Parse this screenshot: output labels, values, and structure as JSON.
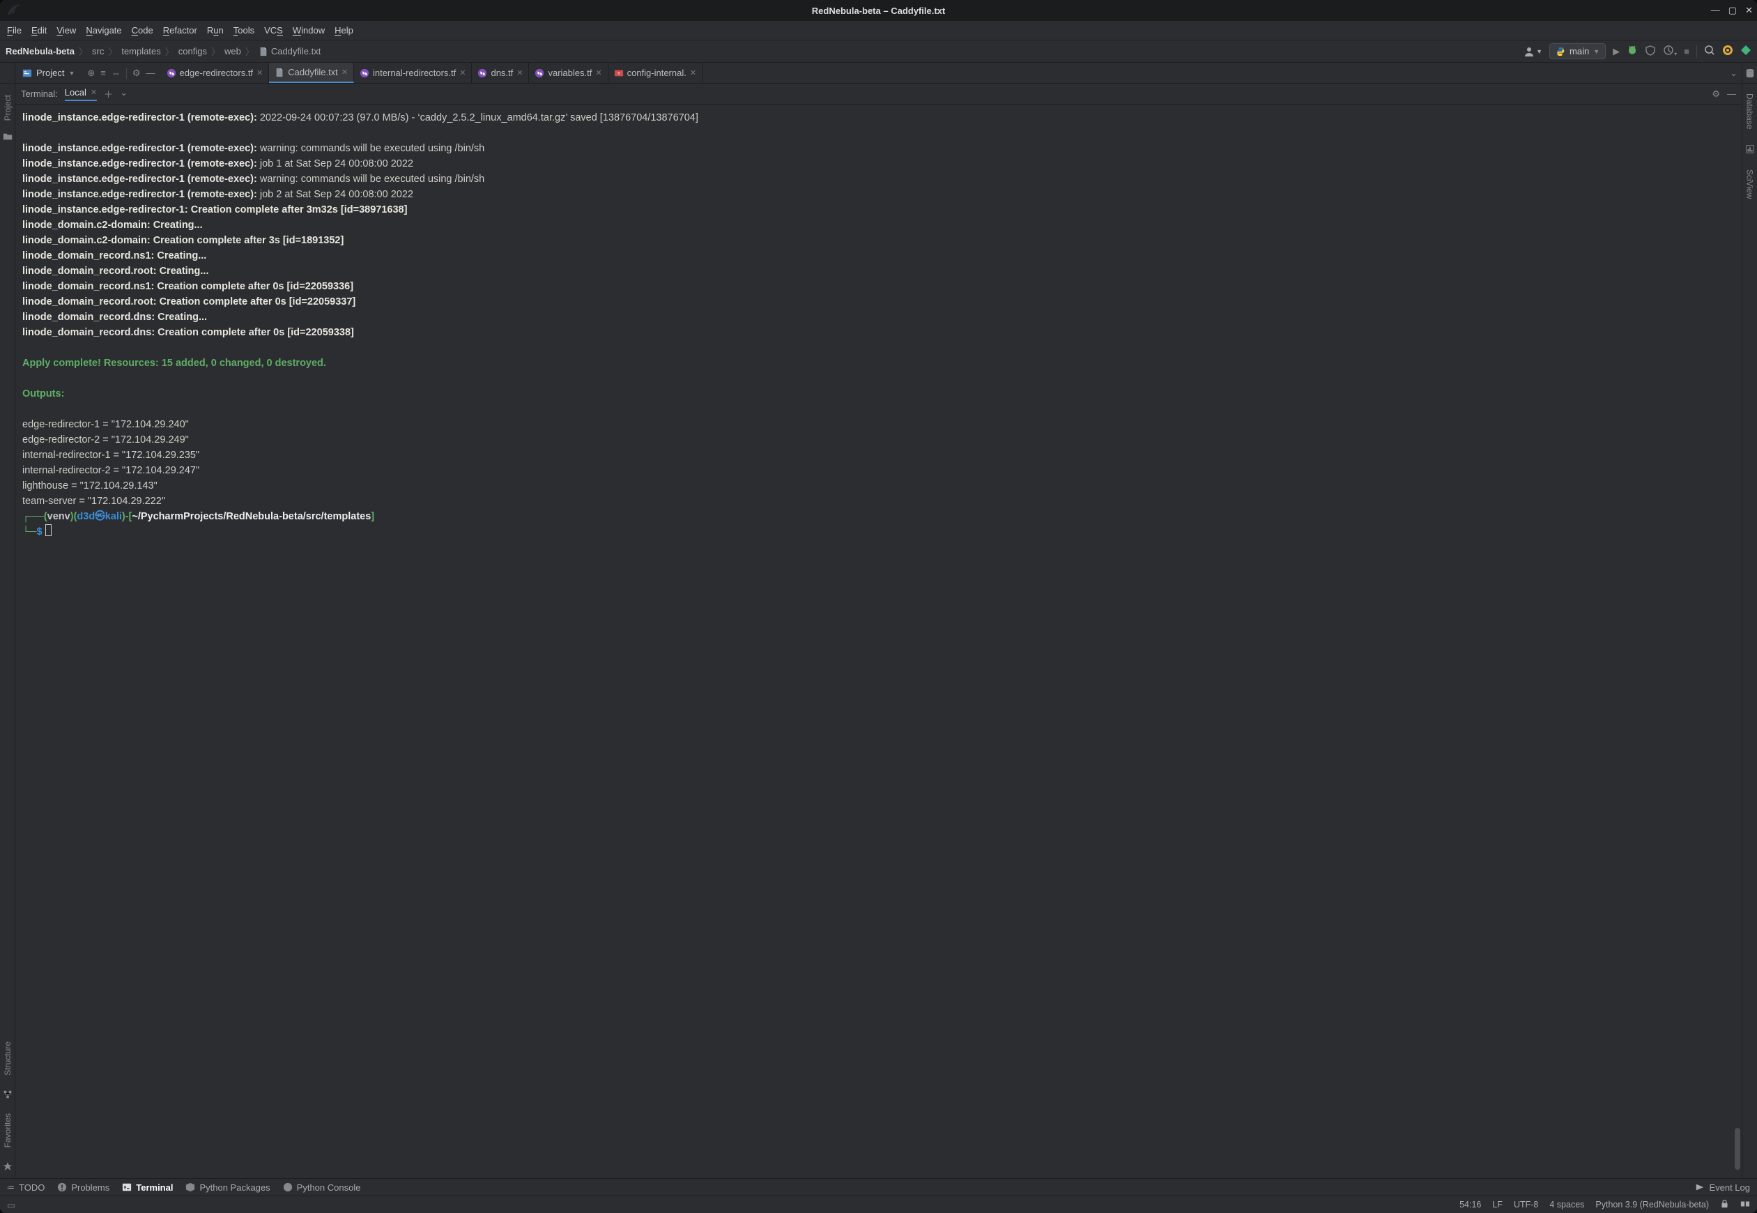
{
  "window": {
    "title": "RedNebula-beta – Caddyfile.txt"
  },
  "menu": {
    "file": "File",
    "edit": "Edit",
    "view": "View",
    "navigate": "Navigate",
    "code": "Code",
    "refactor": "Refactor",
    "run": "Run",
    "tools": "Tools",
    "vcs": "VCS",
    "window": "Window",
    "help": "Help"
  },
  "breadcrumbs": {
    "root": "RedNebula-beta",
    "p1": "src",
    "p2": "templates",
    "p3": "configs",
    "p4": "web",
    "file": "Caddyfile.txt"
  },
  "run_config": {
    "label": "main"
  },
  "project_tool": {
    "label": "Project"
  },
  "editor_tabs": [
    {
      "label": "edge-redirectors.tf",
      "kind": "tf"
    },
    {
      "label": "Caddyfile.txt",
      "kind": "txt",
      "active": true
    },
    {
      "label": "internal-redirectors.tf",
      "kind": "tf"
    },
    {
      "label": "dns.tf",
      "kind": "tf"
    },
    {
      "label": "variables.tf",
      "kind": "tf"
    },
    {
      "label": "config-internal.",
      "kind": "yml"
    }
  ],
  "terminal_header": {
    "title": "Terminal:",
    "tab": "Local"
  },
  "terminal_lines": [
    {
      "bold": "linode_instance.edge-redirector-1 (remote-exec):",
      "rest": " 2022-09-24 00:07:23 (97.0 MB/s) - ‘caddy_2.5.2_linux_amd64.tar.gz’ saved [13876704/13876704]"
    },
    {
      "blank": true
    },
    {
      "bold": "linode_instance.edge-redirector-1 (remote-exec):",
      "rest": " warning: commands will be executed using /bin/sh"
    },
    {
      "bold": "linode_instance.edge-redirector-1 (remote-exec):",
      "rest": " job 1 at Sat Sep 24 00:08:00 2022"
    },
    {
      "bold": "linode_instance.edge-redirector-1 (remote-exec):",
      "rest": " warning: commands will be executed using /bin/sh"
    },
    {
      "bold": "linode_instance.edge-redirector-1 (remote-exec):",
      "rest": " job 2 at Sat Sep 24 00:08:00 2022"
    },
    {
      "bold": "linode_instance.edge-redirector-1: Creation complete after 3m32s [id=38971638]"
    },
    {
      "bold": "linode_domain.c2-domain: Creating..."
    },
    {
      "bold": "linode_domain.c2-domain: Creation complete after 3s [id=1891352]"
    },
    {
      "bold": "linode_domain_record.ns1: Creating..."
    },
    {
      "bold": "linode_domain_record.root: Creating..."
    },
    {
      "bold": "linode_domain_record.ns1: Creation complete after 0s [id=22059336]"
    },
    {
      "bold": "linode_domain_record.root: Creation complete after 0s [id=22059337]"
    },
    {
      "bold": "linode_domain_record.dns: Creating..."
    },
    {
      "bold": "linode_domain_record.dns: Creation complete after 0s [id=22059338]"
    },
    {
      "blank": true
    },
    {
      "green": "Apply complete! Resources: 15 added, 0 changed, 0 destroyed."
    },
    {
      "blank": true
    },
    {
      "green": "Outputs:"
    },
    {
      "blank": true
    },
    {
      "plain": "edge-redirector-1 = \"172.104.29.240\""
    },
    {
      "plain": "edge-redirector-2 = \"172.104.29.249\""
    },
    {
      "plain": "internal-redirector-1 = \"172.104.29.235\""
    },
    {
      "plain": "internal-redirector-2 = \"172.104.29.247\""
    },
    {
      "plain": "lighthouse = \"172.104.29.143\""
    },
    {
      "plain": "team-server = \"172.104.29.222\""
    }
  ],
  "prompt": {
    "l1_a": "┌──(",
    "venv": "venv",
    ")": ")(",
    "user": "d3d",
    "at": "㉿",
    "host": "kali",
    "mid": ")-[",
    "path": "~/PycharmProjects/RedNebula-beta/src/templates",
    "end": "]",
    "l2_a": "└─",
    "dollar": "$ "
  },
  "left_labels": {
    "project": "Project",
    "structure": "Structure",
    "favorites": "Favorites"
  },
  "right_labels": {
    "database": "Database",
    "sciview": "SciView"
  },
  "bottom_tabs": {
    "todo": "TODO",
    "problems": "Problems",
    "terminal": "Terminal",
    "pypkg": "Python Packages",
    "pyconsole": "Python Console",
    "eventlog": "Event Log"
  },
  "status": {
    "pos": "54:16",
    "lf": "LF",
    "enc": "UTF-8",
    "indent": "4 spaces",
    "interp": "Python 3.9 (RedNebula-beta)"
  }
}
